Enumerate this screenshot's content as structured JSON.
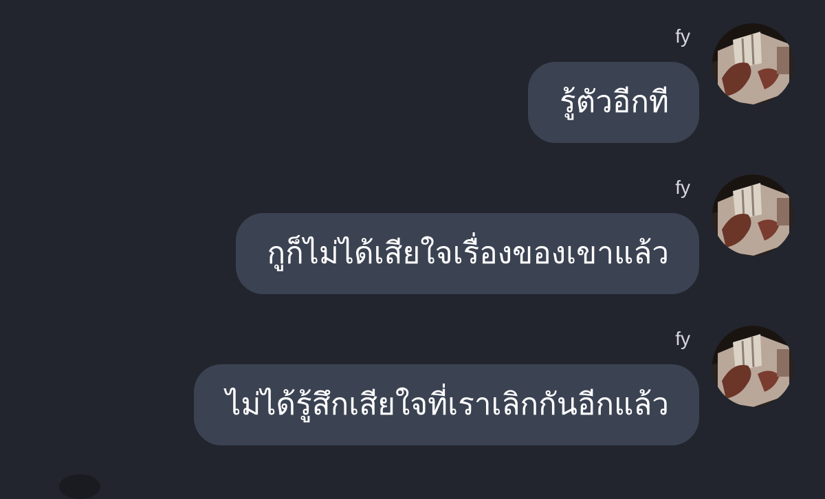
{
  "messages": [
    {
      "sender": "fy",
      "text": "รู้ตัวอีกที"
    },
    {
      "sender": "fy",
      "text": "กูก็ไม่ได้เสียใจเรื่องของเขาแล้ว"
    },
    {
      "sender": "fy",
      "text": "ไม่ได้รู้สึกเสียใจที่เราเลิกกันอีกแล้ว"
    }
  ],
  "colors": {
    "background": "#22252d",
    "bubble": "#3b4252",
    "bubble_text": "#ffffff",
    "sender_text": "#d7d9de"
  },
  "icons": {
    "avatar": "profile-photo-avatar"
  }
}
